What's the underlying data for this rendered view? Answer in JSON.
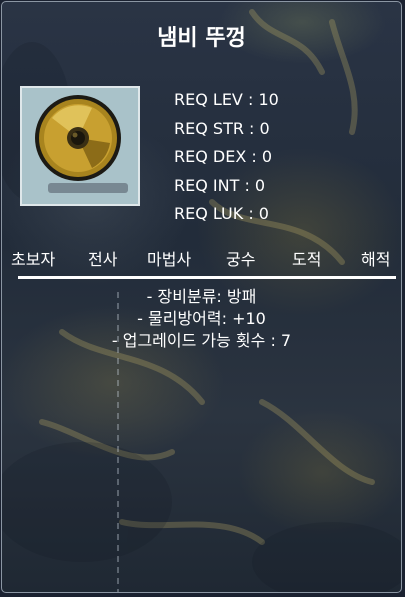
{
  "item": {
    "name": "냄비 뚜껑",
    "icon": "shield-pot-lid-icon"
  },
  "requirements": {
    "lev": "REQ LEV : 10",
    "str": "REQ STR : 0",
    "dex": "REQ DEX : 0",
    "int": "REQ INT : 0",
    "luk": "REQ LUK : 0"
  },
  "jobs": {
    "beginner": "초보자",
    "warrior": "전사",
    "magician": "마법사",
    "bowman": "궁수",
    "thief": "도적",
    "pirate": "해적"
  },
  "description": {
    "category": "- 장비분류: 방패",
    "defense": "- 물리방어력: +10",
    "upgrades": "- 업그레이드 가능 횟수 : 7"
  },
  "colors": {
    "text": "#ffffff",
    "icon_bg": "#a9c2c9",
    "shield_gold": "#c8a030",
    "border": "#8b96a3"
  }
}
